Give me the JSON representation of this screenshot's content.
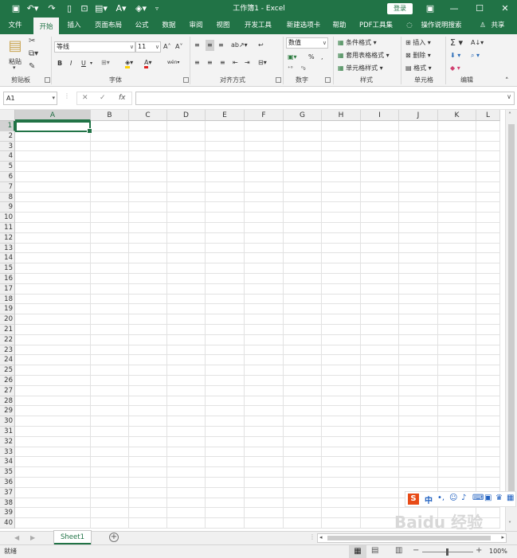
{
  "titlebar": {
    "title": "工作簿1  -  Excel",
    "signin": "登录",
    "save_icon": "save-icon",
    "undo_icon": "undo-icon",
    "redo_icon": "redo-icon"
  },
  "tabs": [
    "文件",
    "开始",
    "插入",
    "页面布局",
    "公式",
    "数据",
    "审阅",
    "视图",
    "开发工具",
    "新建选项卡",
    "帮助",
    "PDF工具集",
    "操作说明搜索",
    "共享"
  ],
  "ribbon": {
    "clipboard": {
      "paste": "粘贴",
      "label": "剪贴板"
    },
    "font": {
      "name": "等线",
      "size": "11",
      "bold": "B",
      "italic": "I",
      "underline": "U",
      "label": "字体",
      "wen": "wén"
    },
    "align": {
      "label": "对齐方式"
    },
    "number": {
      "format": "数值",
      "percent": "%",
      "comma": ",",
      "label": "数字"
    },
    "styles": {
      "cond": "条件格式",
      "table": "套用表格格式",
      "cell": "单元格样式",
      "label": "样式"
    },
    "cells": {
      "insert": "插入",
      "delete": "删除",
      "format": "格式",
      "label": "单元格"
    },
    "edit": {
      "label": "编辑"
    }
  },
  "formulabar": {
    "namebox": "A1",
    "cancel": "✕",
    "enter": "✓",
    "fx": "fx",
    "value": ""
  },
  "columns": [
    "A",
    "B",
    "C",
    "D",
    "E",
    "F",
    "G",
    "H",
    "I",
    "J",
    "K",
    "L"
  ],
  "rows": [
    "1",
    "2",
    "3",
    "4",
    "5",
    "6",
    "7",
    "8",
    "9",
    "10",
    "11",
    "12",
    "13",
    "14",
    "15",
    "16",
    "17",
    "18",
    "19",
    "20",
    "21",
    "22",
    "23",
    "24",
    "25",
    "26",
    "27",
    "28",
    "29",
    "30",
    "31",
    "32",
    "33",
    "34",
    "35",
    "36",
    "37",
    "38",
    "39",
    "40"
  ],
  "selected_cell": "A1",
  "sheets": [
    "Sheet1"
  ],
  "status": {
    "ready": "就绪",
    "zoom": "100%"
  },
  "ime": {
    "s": "S",
    "zh": "中"
  },
  "watermark": "Baidu 经验",
  "colors": {
    "accent": "#217346",
    "grid": "#e2e2e2"
  }
}
